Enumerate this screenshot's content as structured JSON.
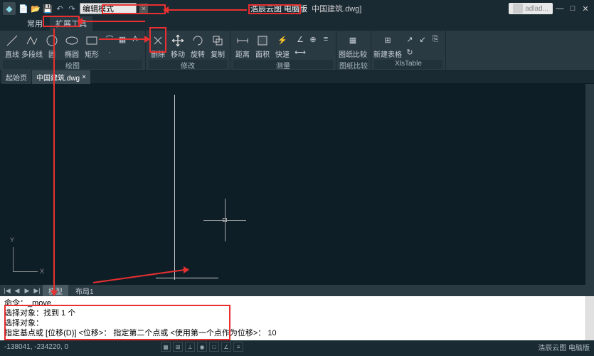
{
  "title": {
    "app_name": "浩辰云图 电脑版",
    "doc_suffix": "中国建筑.dwg]",
    "user": "adlad..."
  },
  "qat": {
    "search_value": "编辑模式",
    "search_close": "×"
  },
  "menu_tabs": {
    "t1": "常用",
    "t2": "扩展工具"
  },
  "ribbon": {
    "draw": {
      "line": "直线",
      "pline": "多段线",
      "circle": "圆",
      "ellipse": "椭圆",
      "rect": "矩形",
      "group_label": "绘图"
    },
    "modify": {
      "delete": "删除",
      "move": "移动",
      "rotate": "旋转",
      "copy": "复制",
      "group_label": "修改"
    },
    "measure": {
      "dist": "距离",
      "area": "面积",
      "quick": "快速",
      "group_label": "测量"
    },
    "compare": {
      "drawing": "图纸比较",
      "table": "新建表格",
      "group_label": "图纸比较",
      "xlstable": "XlsTable"
    }
  },
  "doctabs": {
    "start": "起始页",
    "active": "中国建筑.dwg",
    "close": "×"
  },
  "ucs": {
    "x": "X",
    "y": "Y"
  },
  "modelbar": {
    "model": "模型",
    "layout1": "布局1"
  },
  "cmd": {
    "l1": "命令：_move",
    "l2": "选择对象：找到 1 个",
    "l3": "选择对象：",
    "l4": "指定基点或 [位移(D)] <位移>：  指定第二个点或 <使用第一个点作为位移>： 10"
  },
  "status": {
    "coords": "-138041, -234220, 0",
    "right": "浩辰云图 电脑版"
  }
}
